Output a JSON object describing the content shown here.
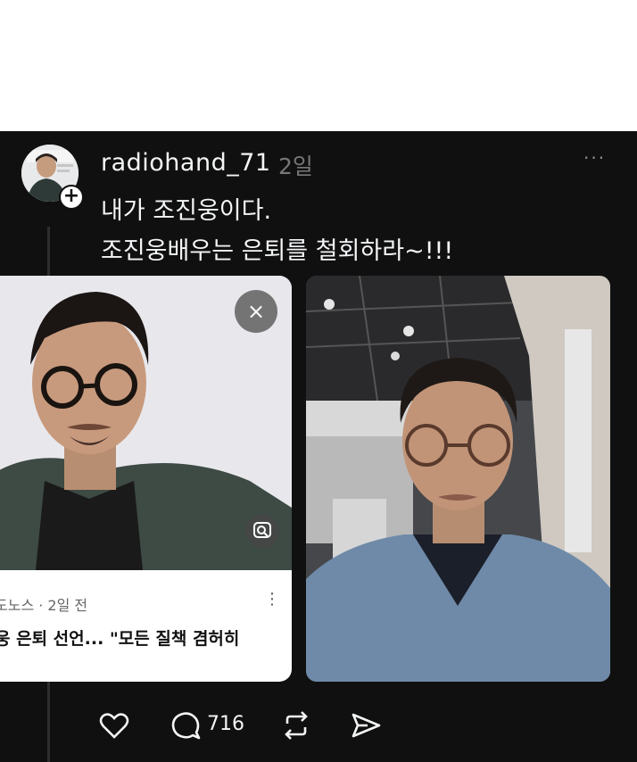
{
  "post": {
    "username": "radiohand_71",
    "timestamp": "2일",
    "more_label": "···",
    "text_lines": [
      "내가 조진웅이다.",
      "조진웅배우는 은퇴를 철회하라~!!!"
    ]
  },
  "news_card": {
    "source": "도노스 · 2일 전",
    "headline": "웅 은퇴 선언... \"모든 질책 겸허히",
    "close_glyph": "×",
    "kebab_glyph": "⋮"
  },
  "actions": {
    "reply_count": "716",
    "icons": [
      "heart-icon",
      "comment-icon",
      "repost-icon",
      "share-icon"
    ]
  },
  "colors": {
    "background": "#101010",
    "text": "#f3f5f7",
    "muted": "#777777"
  }
}
